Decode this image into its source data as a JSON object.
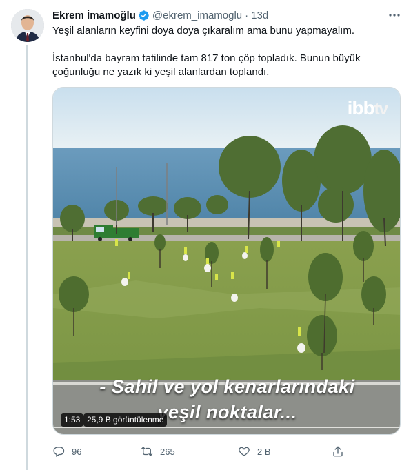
{
  "tweet": {
    "author_name": "Ekrem İmamoğlu",
    "author_handle": "@ekrem_imamoglu",
    "separator": "·",
    "time": "13d",
    "text_para1": "Yeşil alanların keyfini doya doya çıkaralım ama bunu yapmayalım.",
    "text_para2": "İstanbul'da bayram tatilinde tam 817 ton çöp topladık. Bunun büyük çoğunluğu ne yazık ki yeşil alanlardan toplandı."
  },
  "video": {
    "caption_line1": "- Sahil ve yol kenarlarındaki",
    "caption_line2": "yeşil noktalar...",
    "logo_ibb": "ibb",
    "logo_tv": "tv",
    "duration": "1:53",
    "views": "25,9 B görüntülenme"
  },
  "actions": {
    "reply_count": "96",
    "retweet_count": "265",
    "like_count": "2 B",
    "share_count": ""
  },
  "colors": {
    "text": "#0f1419",
    "muted": "#536471",
    "verified": "#1d9bf0",
    "thread_line": "#cfd9de"
  }
}
